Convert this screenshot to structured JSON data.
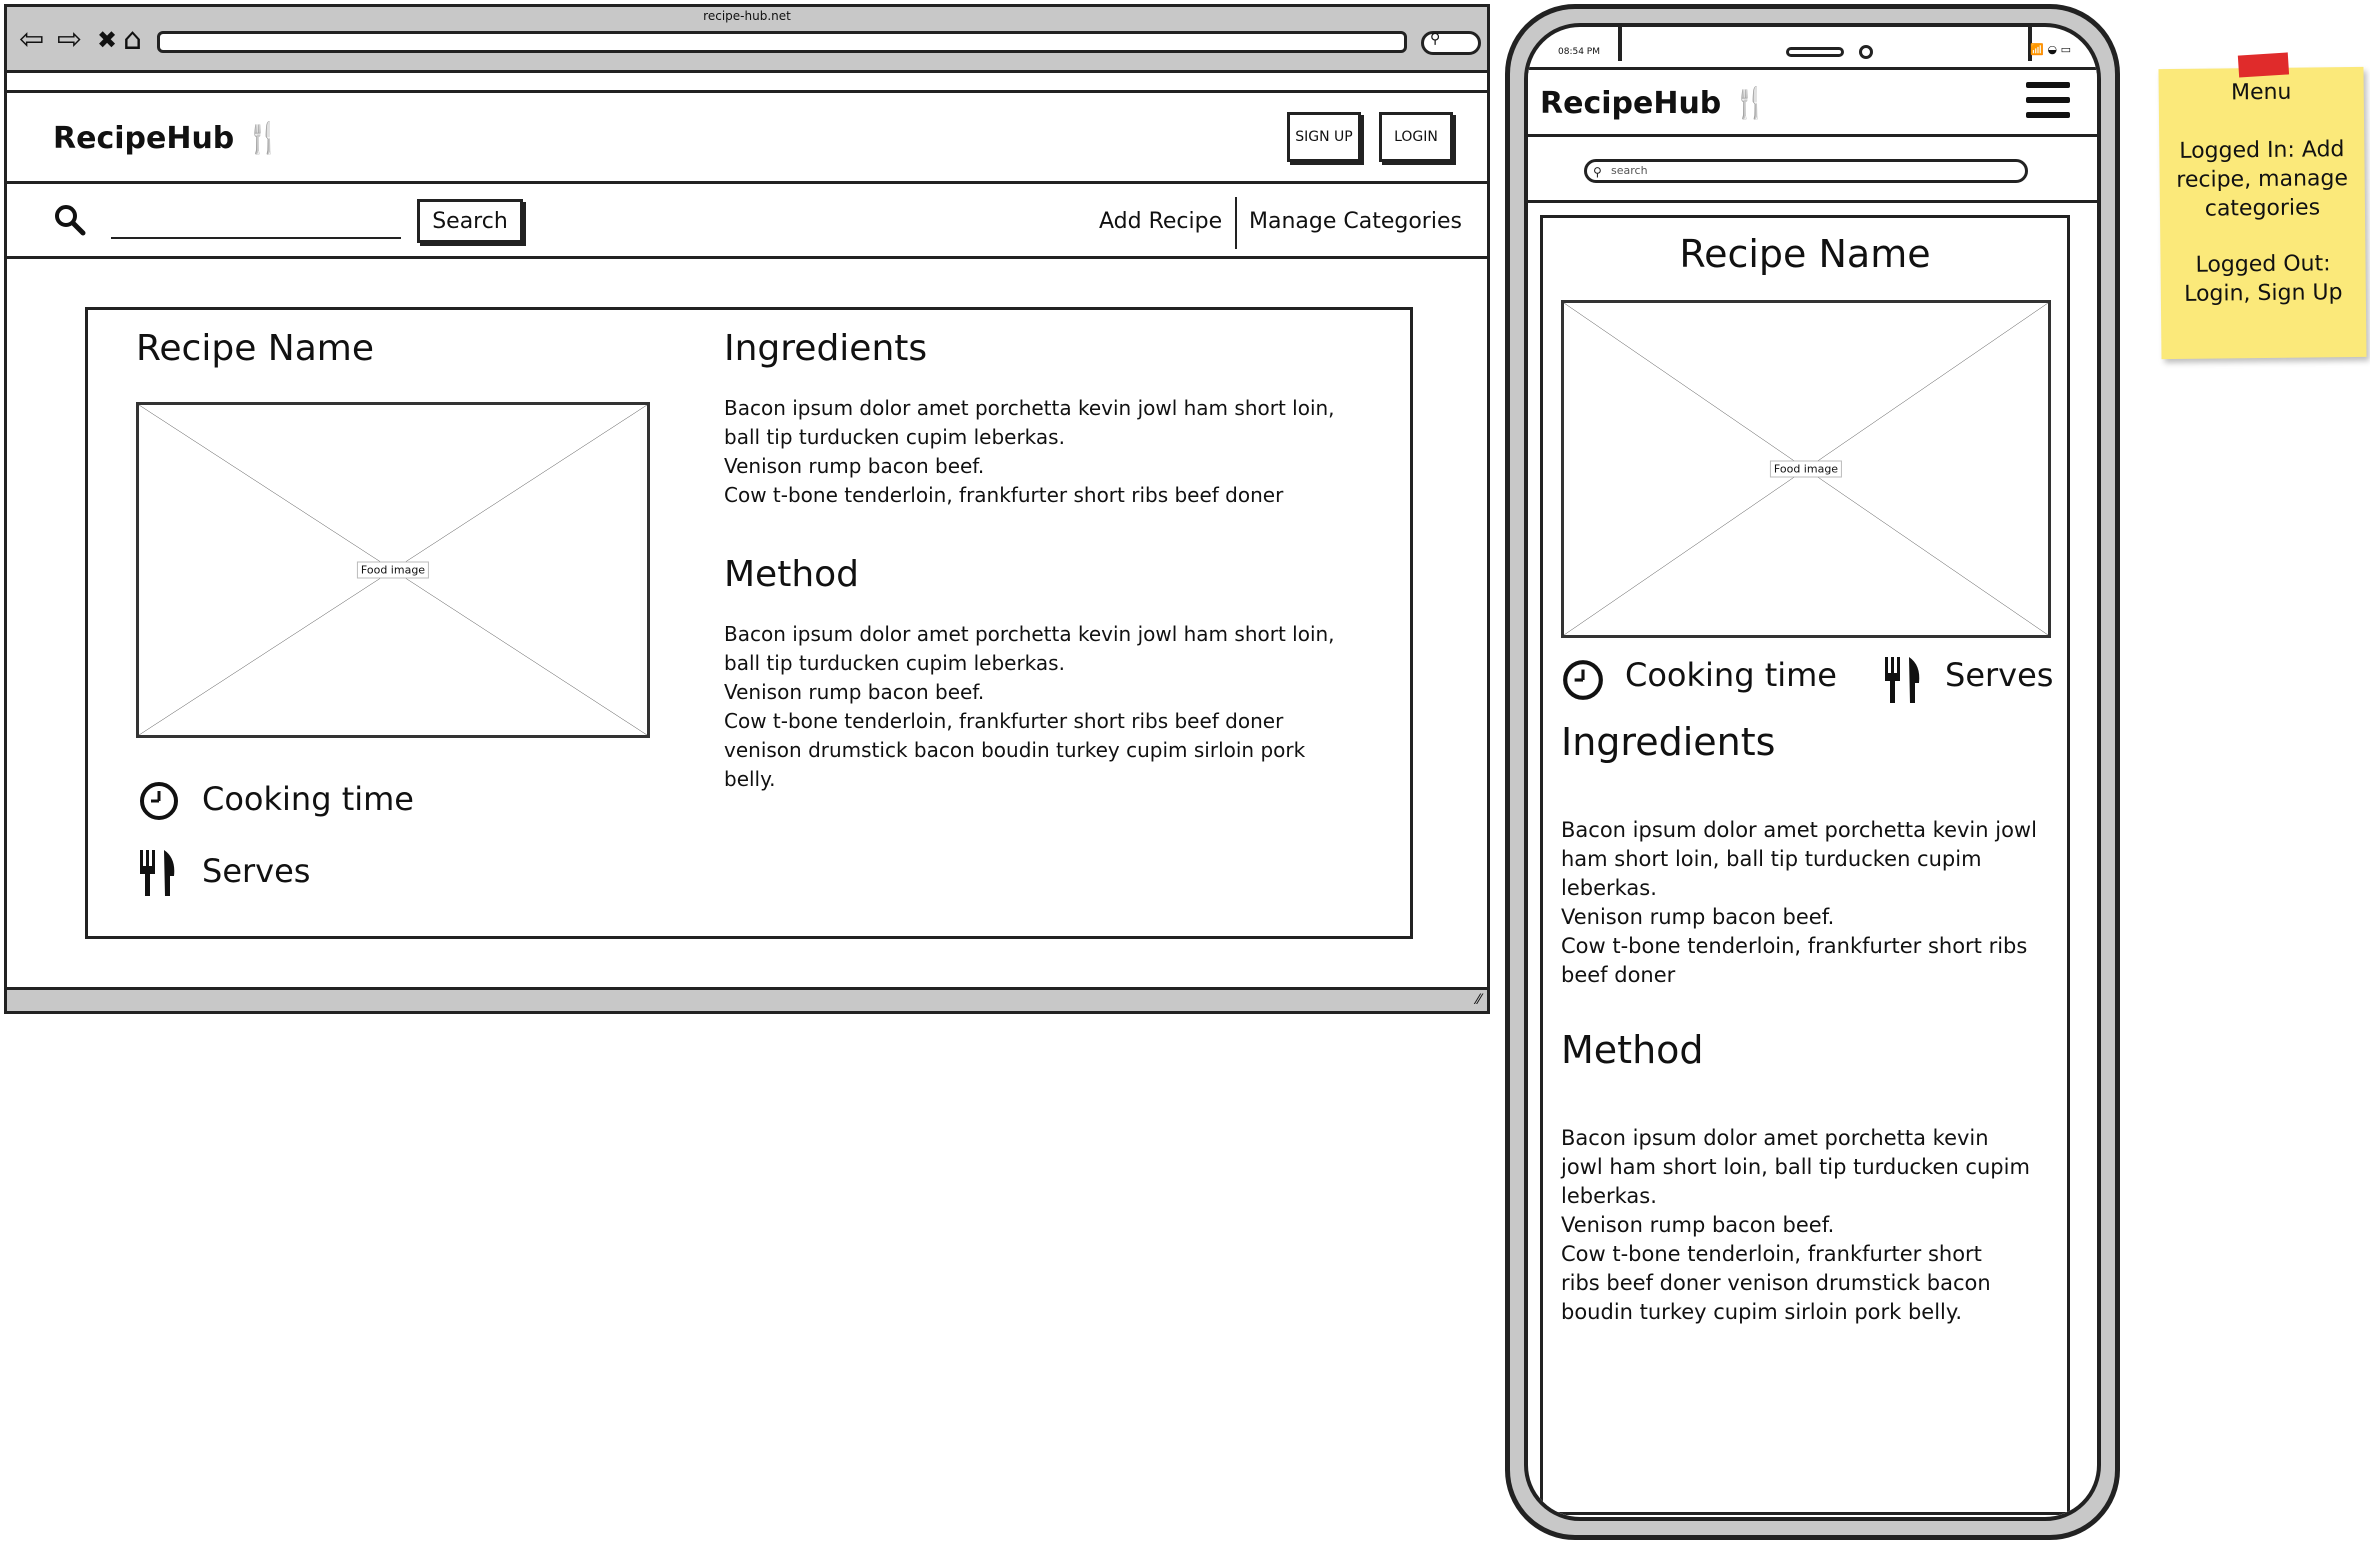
{
  "browser": {
    "url": "recipe-hub.net",
    "nav": {
      "back": "⇦",
      "forward": "⇨",
      "close": "✖",
      "home": "⌂"
    }
  },
  "desktop": {
    "logo": "RecipeHub 🍴",
    "signup_label": "SIGN UP",
    "login_label": "LOGIN",
    "search_button": "Search",
    "nav_add_recipe": "Add Recipe",
    "nav_manage_categories": "Manage Categories",
    "recipe": {
      "name": "Recipe Name",
      "image_label": "Food image",
      "cooking_time": "Cooking time",
      "serves": "Serves",
      "ingredients_title": "Ingredients",
      "ingredients_text": "Bacon ipsum dolor amet porchetta kevin jowl ham short loin,\nball tip turducken cupim leberkas.\nVenison rump bacon beef.\nCow t-bone tenderloin, frankfurter short ribs beef doner",
      "method_title": "Method",
      "method_text": "Bacon ipsum dolor amet porchetta kevin jowl ham short loin,\nball tip turducken cupim leberkas.\nVenison rump bacon beef.\nCow t-bone tenderloin, frankfurter short ribs beef doner\nvenison drumstick bacon boudin turkey cupim sirloin pork\nbelly."
    }
  },
  "phone": {
    "status_time": "08:54 PM",
    "status_icons": "📶 ◒ ▭",
    "logo": "RecipeHub 🍴",
    "search_placeholder": "search",
    "recipe": {
      "name": "Recipe Name",
      "image_label": "Food image",
      "cooking_time": "Cooking time",
      "serves": "Serves",
      "ingredients_title": "Ingredients",
      "ingredients_text": "Bacon ipsum dolor amet porchetta kevin jowl\nham short loin, ball tip turducken cupim\nleberkas.\nVenison rump bacon beef.\nCow t-bone tenderloin, frankfurter short ribs\nbeef doner",
      "method_title": "Method",
      "method_text": "Bacon ipsum dolor amet porchetta kevin\njowl ham short loin, ball tip turducken cupim\nleberkas.\nVenison rump bacon beef.\nCow t-bone tenderloin, frankfurter short\nribs beef doner venison drumstick bacon\nboudin turkey cupim sirloin pork belly."
    }
  },
  "sticky_note": {
    "title": "Menu",
    "logged_in": "Logged In: Add\nrecipe, manage\ncategories",
    "logged_out": "Logged Out:\nLogin, Sign Up",
    "color": "#fbe97a",
    "tape_color": "#e02b2b"
  },
  "icons": {
    "search": "search-icon",
    "clock": "clock-icon",
    "cutlery": "cutlery-icon",
    "hamburger": "hamburger-menu-icon"
  }
}
